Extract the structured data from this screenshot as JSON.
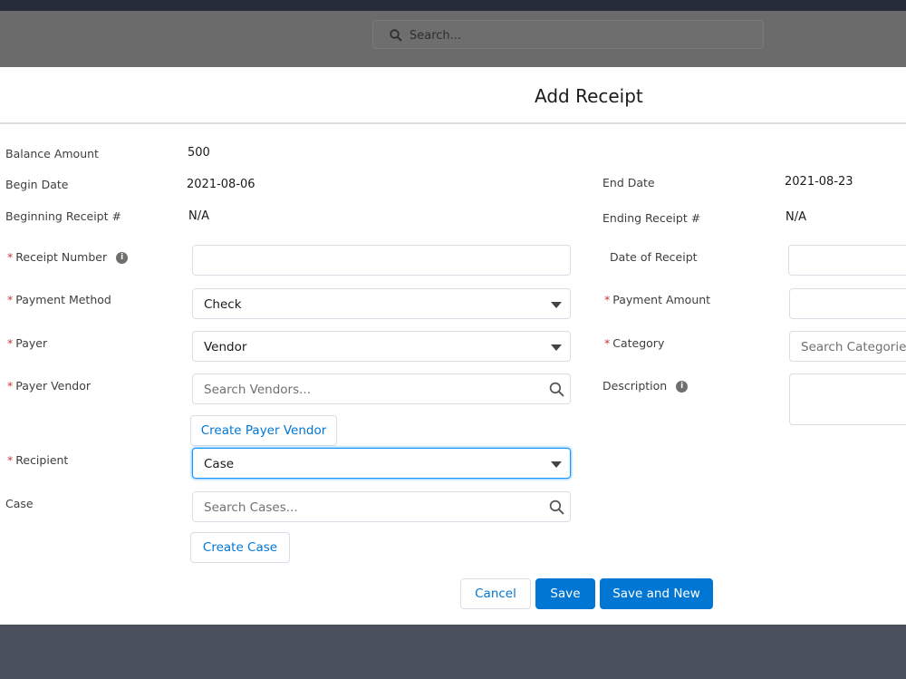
{
  "header": {
    "search_placeholder": "Search..."
  },
  "modal": {
    "title": "Add Receipt"
  },
  "info": {
    "balance_label": "Balance Amount",
    "balance_value": "500",
    "begin_label": "Begin Date",
    "begin_value": "2021-08-06",
    "end_label": "End Date",
    "end_value": "2021-08-23",
    "begin_receipt_label": "Beginning Receipt #",
    "begin_receipt_value": "N/A",
    "end_receipt_label": "Ending Receipt #",
    "end_receipt_value": "N/A"
  },
  "form": {
    "required_mark": "*",
    "info_glyph": "i",
    "receipt_number_label": "Receipt Number",
    "receipt_number_value": "",
    "date_label": "Date of Receipt",
    "date_value": "",
    "payment_method_label": "Payment Method",
    "payment_method_value": "Check",
    "payment_amount_label": "Payment Amount",
    "payment_amount_value": "",
    "payer_label": "Payer",
    "payer_value": "Vendor",
    "category_label": "Category",
    "category_placeholder": "Search Categories...",
    "payer_vendor_label": "Payer Vendor",
    "payer_vendor_placeholder": "Search Vendors...",
    "description_label": "Description",
    "create_vendor_label": "Create Payer Vendor",
    "recipient_label": "Recipient",
    "recipient_value": "Case",
    "case_label": "Case",
    "case_placeholder": "Search Cases...",
    "create_case_label": "Create Case"
  },
  "footer": {
    "cancel": "Cancel",
    "save": "Save",
    "save_new": "Save and New"
  }
}
